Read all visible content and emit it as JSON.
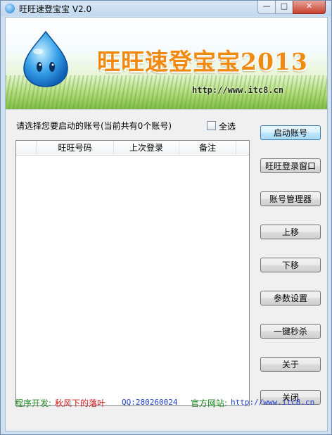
{
  "window": {
    "title": "旺旺速登宝宝 V2.0",
    "controls": {
      "minimize": "—",
      "maximize": "□",
      "close": "✕"
    }
  },
  "banner": {
    "title": "旺旺速登宝宝2013",
    "url": "http://www.itc8.cn",
    "mascot_icon": "water-drop-mascot"
  },
  "accounts": {
    "prompt": "请选择您要启动的账号(当前共有0个账号)",
    "select_all_label": "全选",
    "select_all_checked": false,
    "columns": [
      "",
      "旺旺号码",
      "上次登录",
      "备注"
    ],
    "rows": []
  },
  "buttons": {
    "start": "启动账号",
    "login_window": "旺旺登录窗口",
    "account_manager": "账号管理器",
    "move_up": "上移",
    "move_down": "下移",
    "settings": "参数设置",
    "one_click_kill": "一键秒杀",
    "about": "关于",
    "close": "关闭"
  },
  "footer": {
    "developer_label": "程序开发:",
    "developer_name": "秋风下的落叶",
    "qq": "QQ:280260024",
    "site_label": "官方网站:",
    "site_url": "http://www.itc8.cn"
  },
  "colors": {
    "banner_title": "#f08a10",
    "footer_label": "#1f8a1f",
    "developer_name": "#d61a1a",
    "link": "#1f3fd0",
    "focused_button": "#bee6fd"
  }
}
